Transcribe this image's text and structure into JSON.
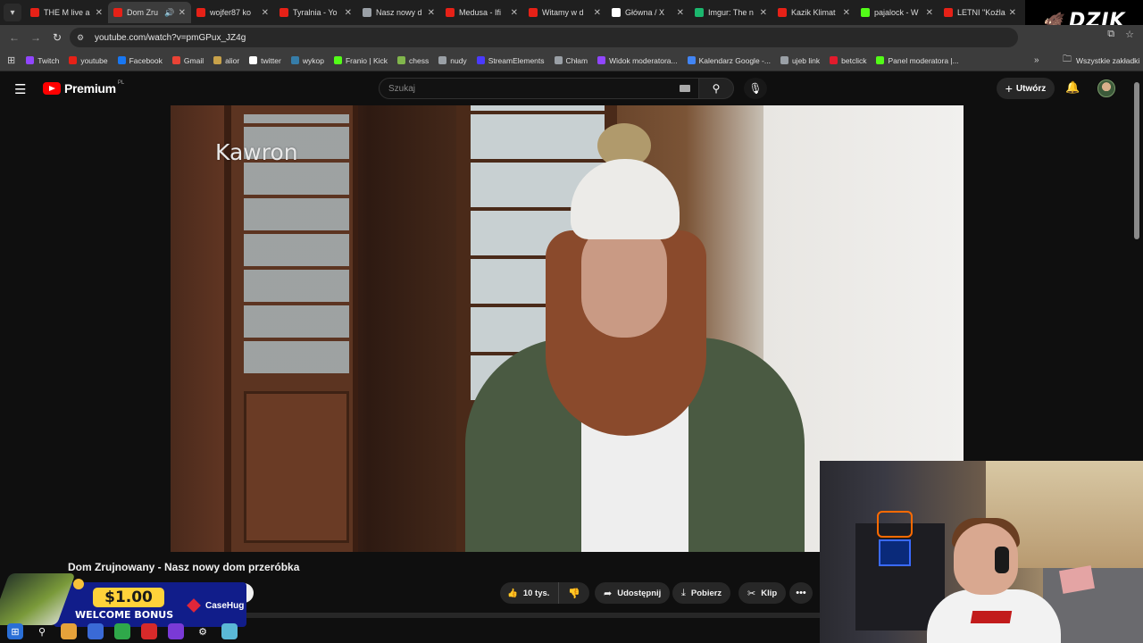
{
  "tabs": [
    {
      "title": "THE M live a",
      "color": "#e62117",
      "active": false
    },
    {
      "title": "Dom Zru",
      "color": "#e62117",
      "active": true
    },
    {
      "title": "wojfer87 ko",
      "color": "#e62117",
      "active": false
    },
    {
      "title": "Tyralnia - Yo",
      "color": "#e62117",
      "active": false
    },
    {
      "title": "Nasz nowy d",
      "color": "#9aa0a6",
      "active": false
    },
    {
      "title": "Medusa - Ifi",
      "color": "#e62117",
      "active": false
    },
    {
      "title": "Witamy w d",
      "color": "#e62117",
      "active": false
    },
    {
      "title": "Główna / X",
      "color": "#ffffff",
      "active": false
    },
    {
      "title": "Imgur: The n",
      "color": "#1bb76e",
      "active": false
    },
    {
      "title": "Kazik Klimat",
      "color": "#e62117",
      "active": false
    },
    {
      "title": "pajalock - W",
      "color": "#53fc18",
      "active": false
    },
    {
      "title": "LETNI \"Koźla",
      "color": "#e62117",
      "active": false
    }
  ],
  "address": {
    "url": "youtube.com/watch?v=pmGPux_JZ4g"
  },
  "bookmarks": [
    {
      "label": "Twitch",
      "color": "#9146ff"
    },
    {
      "label": "youtube",
      "color": "#e62117"
    },
    {
      "label": "Facebook",
      "color": "#1877f2"
    },
    {
      "label": "Gmail",
      "color": "#ea4335"
    },
    {
      "label": "alior",
      "color": "#c8a24a"
    },
    {
      "label": "twitter",
      "color": "#ffffff"
    },
    {
      "label": "wykop",
      "color": "#367da9"
    },
    {
      "label": "Franio | Kick",
      "color": "#53fc18"
    },
    {
      "label": "chess",
      "color": "#81b64c"
    },
    {
      "label": "nudy",
      "color": "#9aa0a6"
    },
    {
      "label": "StreamElements",
      "color": "#4a3aff"
    },
    {
      "label": "Chłam",
      "color": "#9aa0a6"
    },
    {
      "label": "Widok moderatora...",
      "color": "#9146ff"
    },
    {
      "label": "Kalendarz Google -...",
      "color": "#4285f4"
    },
    {
      "label": "ujeb link",
      "color": "#9aa0a6"
    },
    {
      "label": "betclick",
      "color": "#e21b2c"
    },
    {
      "label": "Panel moderatora |...",
      "color": "#53fc18"
    }
  ],
  "bookmarks_more": "»",
  "all_bookmarks": "Wszystkie zakładki",
  "overlay_logo": "DZIK",
  "youtube": {
    "logo_text": "Premium",
    "country": "PL",
    "search_placeholder": "Szukaj",
    "create_label": "Utwórz"
  },
  "video": {
    "watermark": "Kawron",
    "title": "Dom Zrujnowany - Nasz nowy dom przeróbka",
    "likes": "10 tys.",
    "share_label": "Udostępnij",
    "download_label": "Pobierz",
    "clip_label": "Klip"
  },
  "ad": {
    "amount": "$1.00",
    "bonus_text": "WELCOME BONUS",
    "brand": "CaseHug"
  },
  "icons": {
    "menu": "hamburger-icon",
    "search": "search-icon",
    "mic": "microphone-icon",
    "bell": "bell-icon",
    "like": "thumbs-up-icon",
    "dislike": "thumbs-down-icon",
    "share": "share-icon",
    "download": "download-icon",
    "clip": "scissors-icon",
    "more": "more-horizontal-icon"
  }
}
